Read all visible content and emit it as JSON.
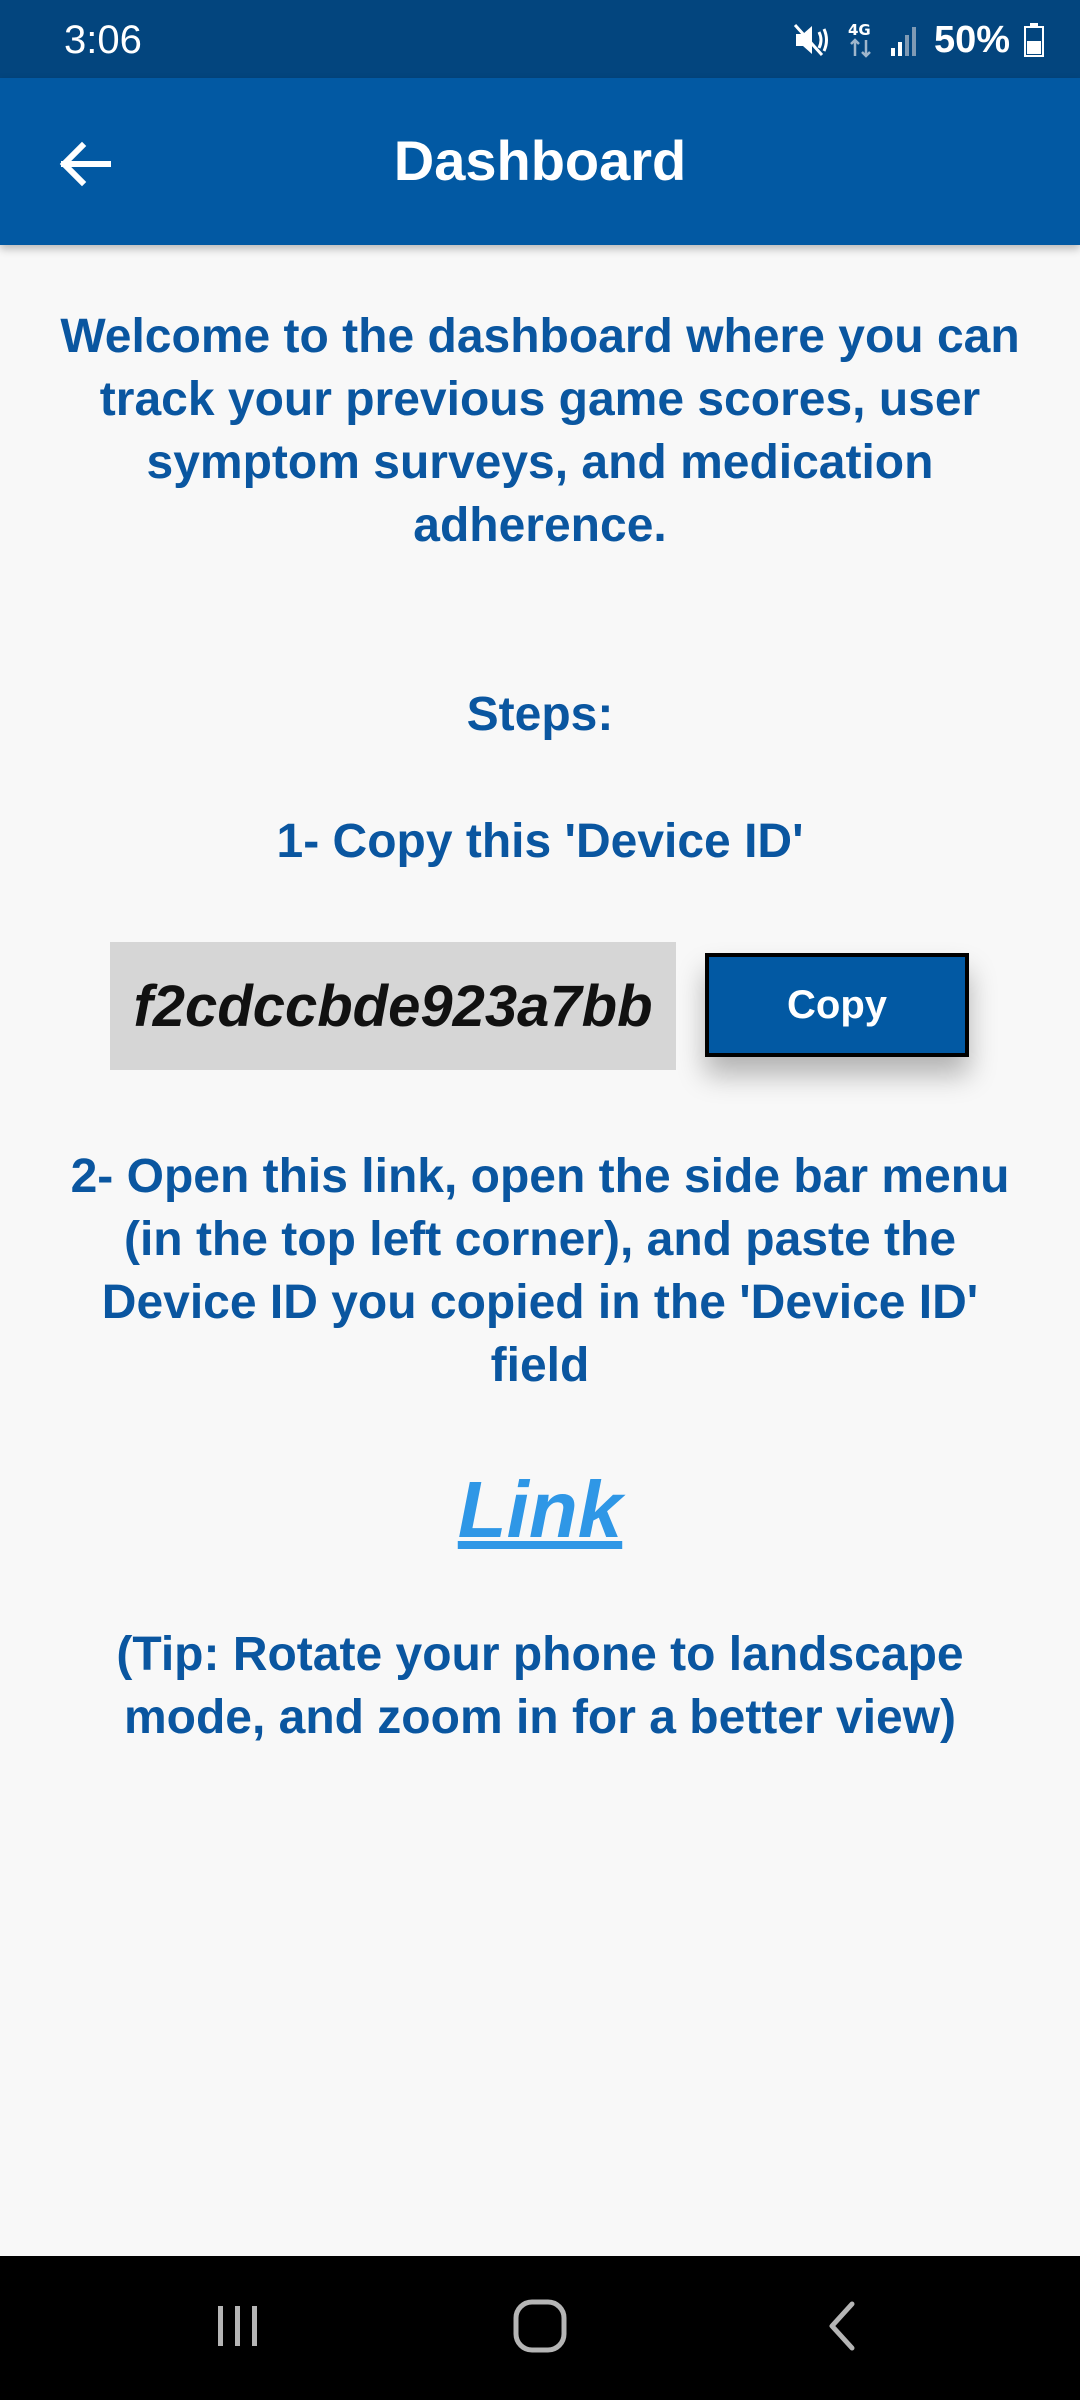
{
  "status_bar": {
    "time": "3:06",
    "battery": "50%",
    "icons": [
      "mute-vibrate-icon",
      "4g-data-icon",
      "signal-icon",
      "battery-icon"
    ]
  },
  "app_bar": {
    "title": "Dashboard",
    "back_icon": "arrow-left-icon"
  },
  "content": {
    "welcome": "Welcome to the dashboard where you can track your previous game scores, user symptom surveys, and medication adherence.",
    "steps_title": "Steps:",
    "step1": "1- Copy this 'Device ID'",
    "device_id": "f2cdccbde923a7bb",
    "copy_label": "Copy",
    "step2": "2- Open this link, open the side bar menu (in the top left corner), and paste the Device ID you copied in the 'Device ID' field",
    "link_label": "Link",
    "tip": "(Tip: Rotate your phone to landscape mode, and zoom in for a better view)"
  },
  "nav_bar": {
    "icons": [
      "recent-apps-icon",
      "home-icon",
      "back-icon"
    ]
  },
  "colors": {
    "status_bar_bg": "#03457e",
    "app_bar_bg": "#0259a3",
    "text_primary": "#0a56a0",
    "link": "#2f97e6",
    "device_id_bg": "#d6d6d6",
    "page_bg": "#f8f8f8"
  }
}
